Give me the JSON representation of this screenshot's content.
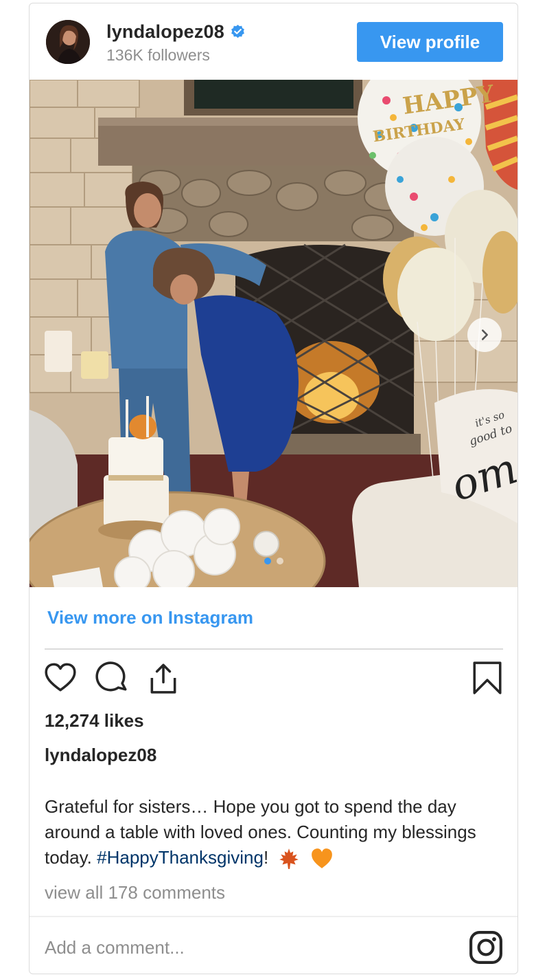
{
  "header": {
    "username": "lyndalopez08",
    "followers": "136K followers",
    "view_profile_label": "View profile"
  },
  "photo": {
    "pillow_text_1": "it's so",
    "pillow_text_2": "good to",
    "pillow_text_3": "ome",
    "balloon_text_1": "HAPPY",
    "balloon_text_2": "BIRTHDAY",
    "carousel": {
      "total": 2,
      "active": 1
    }
  },
  "view_more_label": "View more on Instagram",
  "likes": "12,274 likes",
  "caption": {
    "username": "lyndalopez08",
    "text": "Grateful for sisters… Hope you got to spend the day around a table with loved ones. Counting my blessings today. ",
    "hashtag": "#HappyThanksgiving",
    "after": "!"
  },
  "view_comments": "view all 178 comments",
  "comment_placeholder": "Add a comment...",
  "colors": {
    "accent": "#3897f0",
    "hashtag": "#003569",
    "muted": "#8e8e8e"
  },
  "icons": [
    "verified-badge-icon",
    "chevron-right-icon",
    "heart-icon",
    "comment-icon",
    "share-icon",
    "bookmark-icon",
    "maple-leaf-icon",
    "orange-heart-icon",
    "instagram-icon"
  ]
}
